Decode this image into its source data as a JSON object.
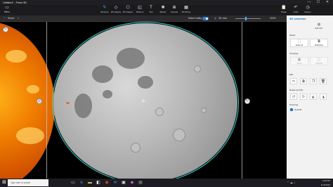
{
  "window": {
    "title": "Untitled* - Paint 3D",
    "minimize": "—",
    "maximize": "☐",
    "close": "✕"
  },
  "ribbon": {
    "menu": {
      "label": "Menu",
      "icon": "folder-icon"
    },
    "tools": [
      {
        "label": "Brushes",
        "icon": "brush-icon"
      },
      {
        "label": "2D shapes",
        "icon": "shapes-2d-icon"
      },
      {
        "label": "3D shapes",
        "icon": "shapes-3d-icon"
      },
      {
        "label": "Stickers",
        "icon": "sticker-icon"
      },
      {
        "label": "Text",
        "icon": "text-icon"
      },
      {
        "label": "Effects",
        "icon": "effects-icon"
      },
      {
        "label": "Canvas",
        "icon": "canvas-icon"
      },
      {
        "label": "3D library",
        "icon": "library-icon"
      }
    ],
    "right": [
      {
        "label": "Paste",
        "icon": "paste-icon"
      },
      {
        "label": "Undo",
        "icon": "undo-icon"
      },
      {
        "label": "History",
        "icon": "history-icon"
      }
    ]
  },
  "subbar": {
    "select": "Select",
    "mixed_reality": "Mixed reality",
    "view_3d": "3D view",
    "zoom": "202%"
  },
  "panel": {
    "title": "3D selection",
    "edit_color": "Edit color",
    "select_label": "Select",
    "select_all": "Select all",
    "multiselect": "Multiselect",
    "grouping_label": "Grouping",
    "group": "Group",
    "ungroup": "Ungroup",
    "edit_label": "Edit",
    "rotate_flip_label": "Rotate and flip",
    "texturing_label": "Texturing",
    "smooth": "Smooth"
  },
  "taskbar": {
    "search_placeholder": "Type here to search",
    "time": "4:29 PM",
    "date": "1/19/2019"
  },
  "colors": {
    "accent": "#1a73c9",
    "selection": "#36d6d0",
    "sun": "#f07d00"
  }
}
